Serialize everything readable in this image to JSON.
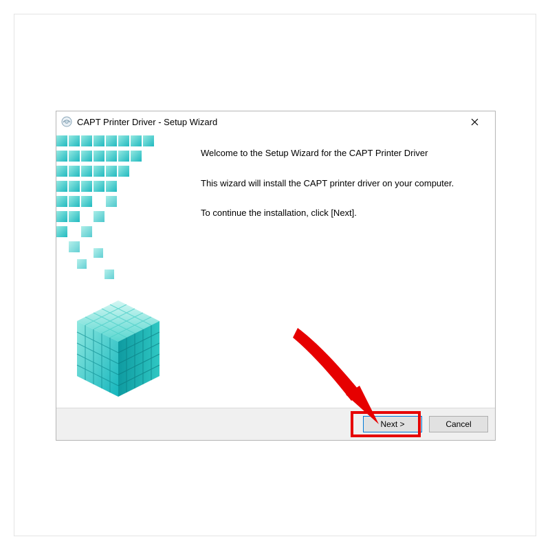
{
  "window": {
    "title": "CAPT Printer Driver - Setup Wizard"
  },
  "content": {
    "welcome_line": "Welcome to the Setup Wizard for the CAPT Printer Driver",
    "description_line": "This wizard will install the CAPT printer driver on your computer.",
    "continue_line": "To continue the installation, click [Next]."
  },
  "buttons": {
    "next": "Next >",
    "cancel": "Cancel"
  }
}
